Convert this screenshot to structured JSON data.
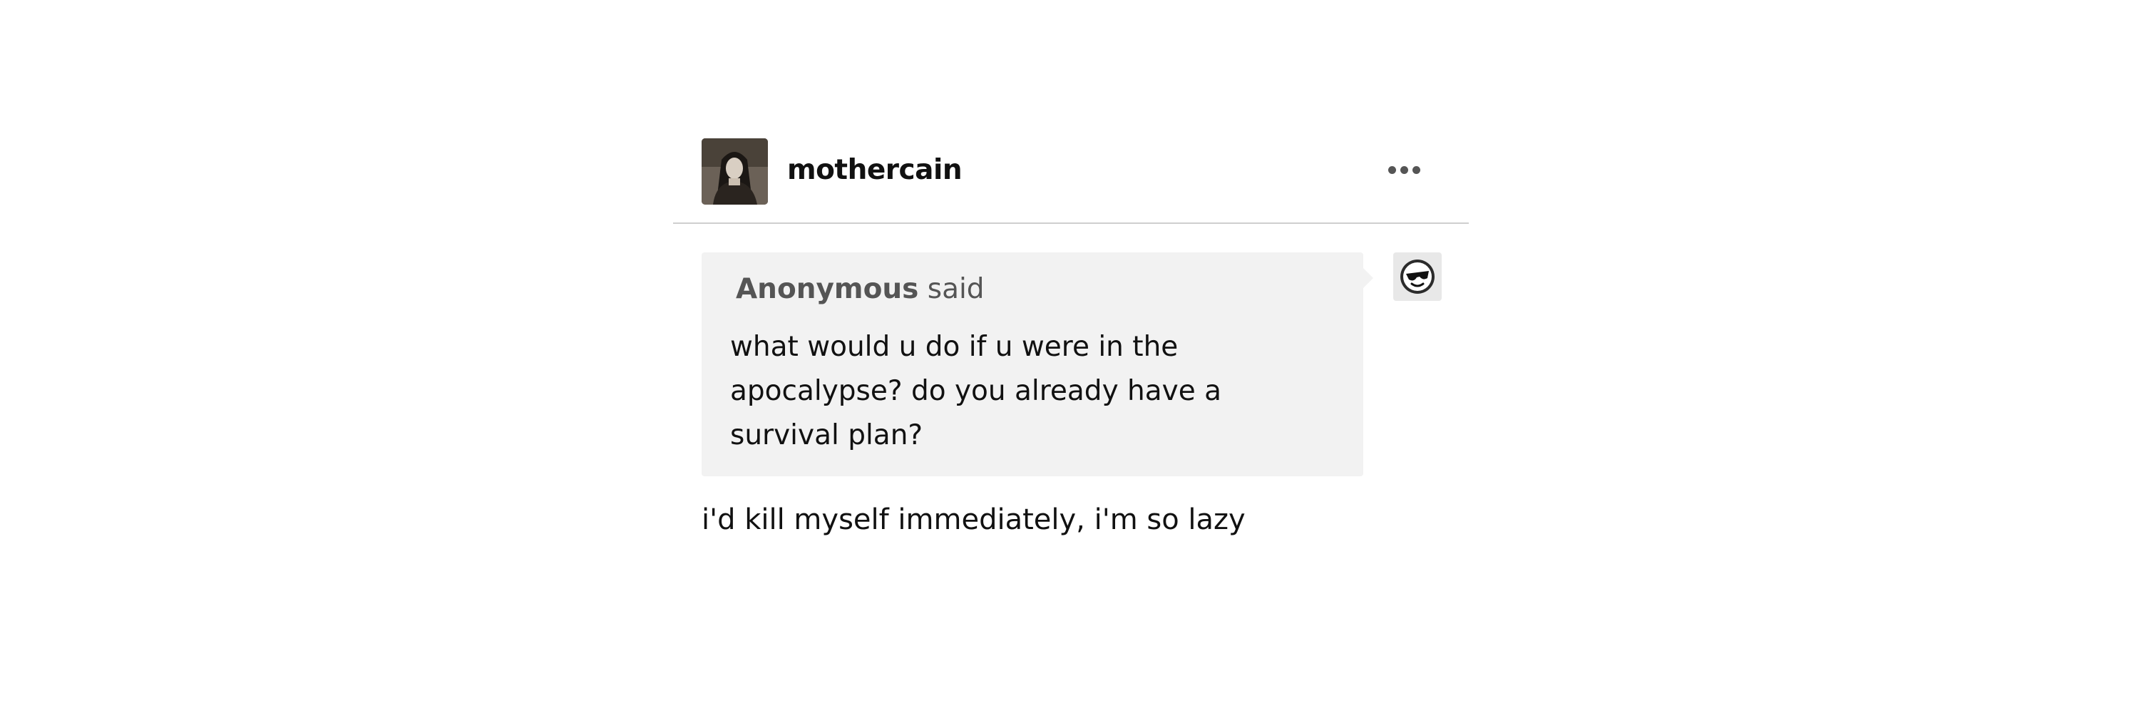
{
  "post": {
    "header": {
      "username": "mothercain",
      "avatar_icon": "user-avatar-photo",
      "more_icon": "more-options-icon"
    },
    "ask": {
      "asker_name": "Anonymous",
      "asker_verb": "said",
      "asker_avatar_icon": "anonymous-sunglasses-avatar-icon",
      "question": "what would u do if u were in the apocalypse? do you already have a survival plan?"
    },
    "answer": "i'd kill myself immediately, i'm so lazy"
  },
  "colors": {
    "background": "#ffffff",
    "ask_background": "#f2f2f2",
    "divider": "#cfcfcf",
    "text": "#111111",
    "muted_text": "#555555"
  }
}
